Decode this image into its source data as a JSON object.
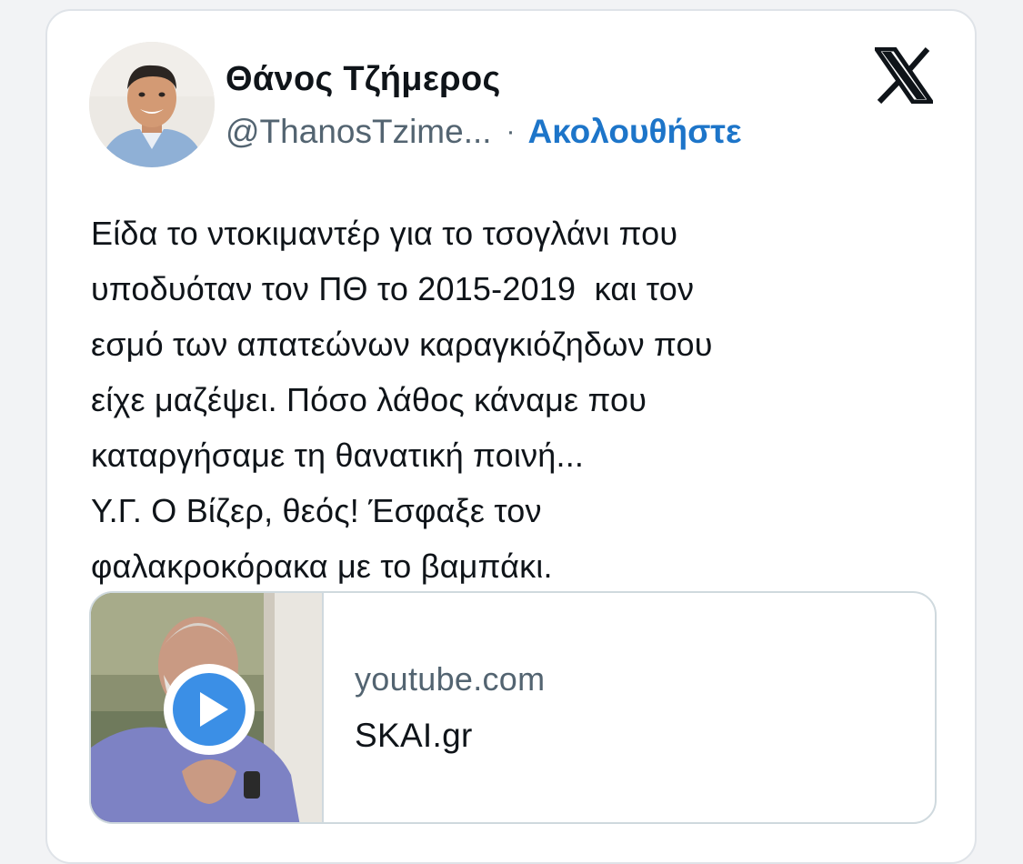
{
  "tweet": {
    "author": {
      "name": "Θάνος Τζήμερος",
      "handle": "@ThanosTzime...",
      "separator": "·",
      "follow_label": "Ακολουθήστε"
    },
    "platform_icon": "x-logo-icon",
    "text_lines": [
      "Είδα το ντοκιμαντέρ για το τσογλάνι που",
      "υποδυόταν τον ΠΘ το 2015-2019  και τον",
      "εσμό των απατεώνων καραγκιόζηδων που",
      "είχε μαζέψει. Πόσο λάθος κάναμε που",
      "καταργήσαμε τη θανατική ποινή...",
      "Υ.Γ. Ο Βίζερ, θεός! Έσφαξε τον",
      "φαλακροκόρακα με το βαμπάκι."
    ],
    "link_card": {
      "domain": "youtube.com",
      "title": "SKAI.gr",
      "thumbnail_icon": "play-icon"
    }
  },
  "colors": {
    "follow": "#1d75c9",
    "muted": "#536471",
    "text": "#0f1419",
    "border": "#cfd9de",
    "play": "#3b8fe6"
  }
}
